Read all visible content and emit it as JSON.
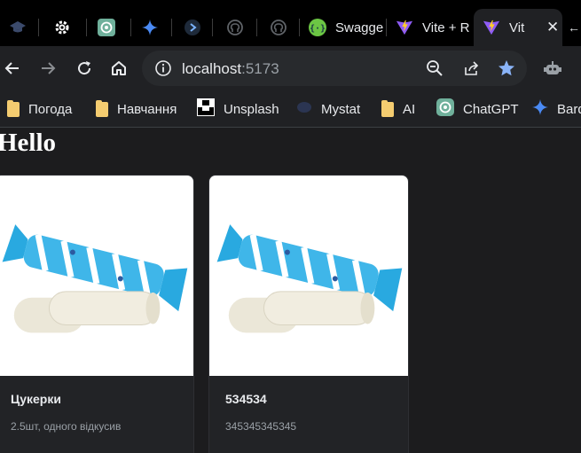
{
  "browser": {
    "tabs": [
      {
        "title": "",
        "icon": "graduation-cap-icon"
      },
      {
        "title": "",
        "icon": "gear-icon"
      },
      {
        "title": "",
        "icon": "chatgpt-icon"
      },
      {
        "title": "",
        "icon": "gemini-icon"
      },
      {
        "title": "",
        "icon": "play-icon"
      },
      {
        "title": "",
        "icon": "github-icon"
      },
      {
        "title": "",
        "icon": "github-icon"
      },
      {
        "title": "Swagge",
        "icon": "swagger-icon"
      },
      {
        "title": "Vite + R",
        "icon": "vite-icon"
      },
      {
        "title": "Vit",
        "icon": "vite-icon",
        "active": true
      }
    ],
    "url_host": "localhost",
    "url_port": ":5173",
    "bookmarks": [
      {
        "label": "Погода",
        "icon": "folder-icon"
      },
      {
        "label": "Навчання",
        "icon": "folder-icon"
      },
      {
        "label": "Unsplash",
        "icon": "unsplash-icon"
      },
      {
        "label": "Mystat",
        "icon": "mystat-icon"
      },
      {
        "label": "AI",
        "icon": "folder-icon"
      },
      {
        "label": "ChatGPT",
        "icon": "chatgpt-icon"
      },
      {
        "label": "Bard",
        "icon": "gemini-icon"
      }
    ],
    "colors": {
      "accent_star": "#8ab4f8",
      "folder": "#f4cc70"
    }
  },
  "page": {
    "heading": "Hello",
    "cards": [
      {
        "title": "Цукерки",
        "description": "2.5шт, одного відкусив",
        "image": "candy-image"
      },
      {
        "title": "534534",
        "description": "345345345345",
        "image": "candy-image"
      }
    ]
  }
}
